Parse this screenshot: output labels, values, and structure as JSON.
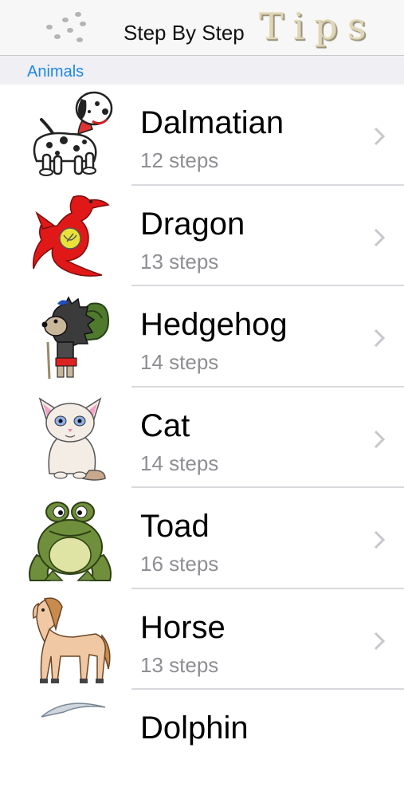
{
  "nav": {
    "title": "Step By Step",
    "logo_text": "Tips"
  },
  "section": {
    "title": "Animals"
  },
  "items": [
    {
      "name": "Dalmatian",
      "steps": "12 steps",
      "icon": "dalmatian-icon"
    },
    {
      "name": "Dragon",
      "steps": "13 steps",
      "icon": "dragon-icon"
    },
    {
      "name": "Hedgehog",
      "steps": "14 steps",
      "icon": "hedgehog-icon"
    },
    {
      "name": "Cat",
      "steps": "14 steps",
      "icon": "cat-icon"
    },
    {
      "name": "Toad",
      "steps": "16 steps",
      "icon": "toad-icon"
    },
    {
      "name": "Horse",
      "steps": "13 steps",
      "icon": "horse-icon"
    },
    {
      "name": "Dolphin",
      "steps": "",
      "icon": "dolphin-icon"
    }
  ],
  "colors": {
    "accent": "#1e88e5",
    "subtitle": "#8e8e93",
    "separator": "#d9d9de"
  }
}
